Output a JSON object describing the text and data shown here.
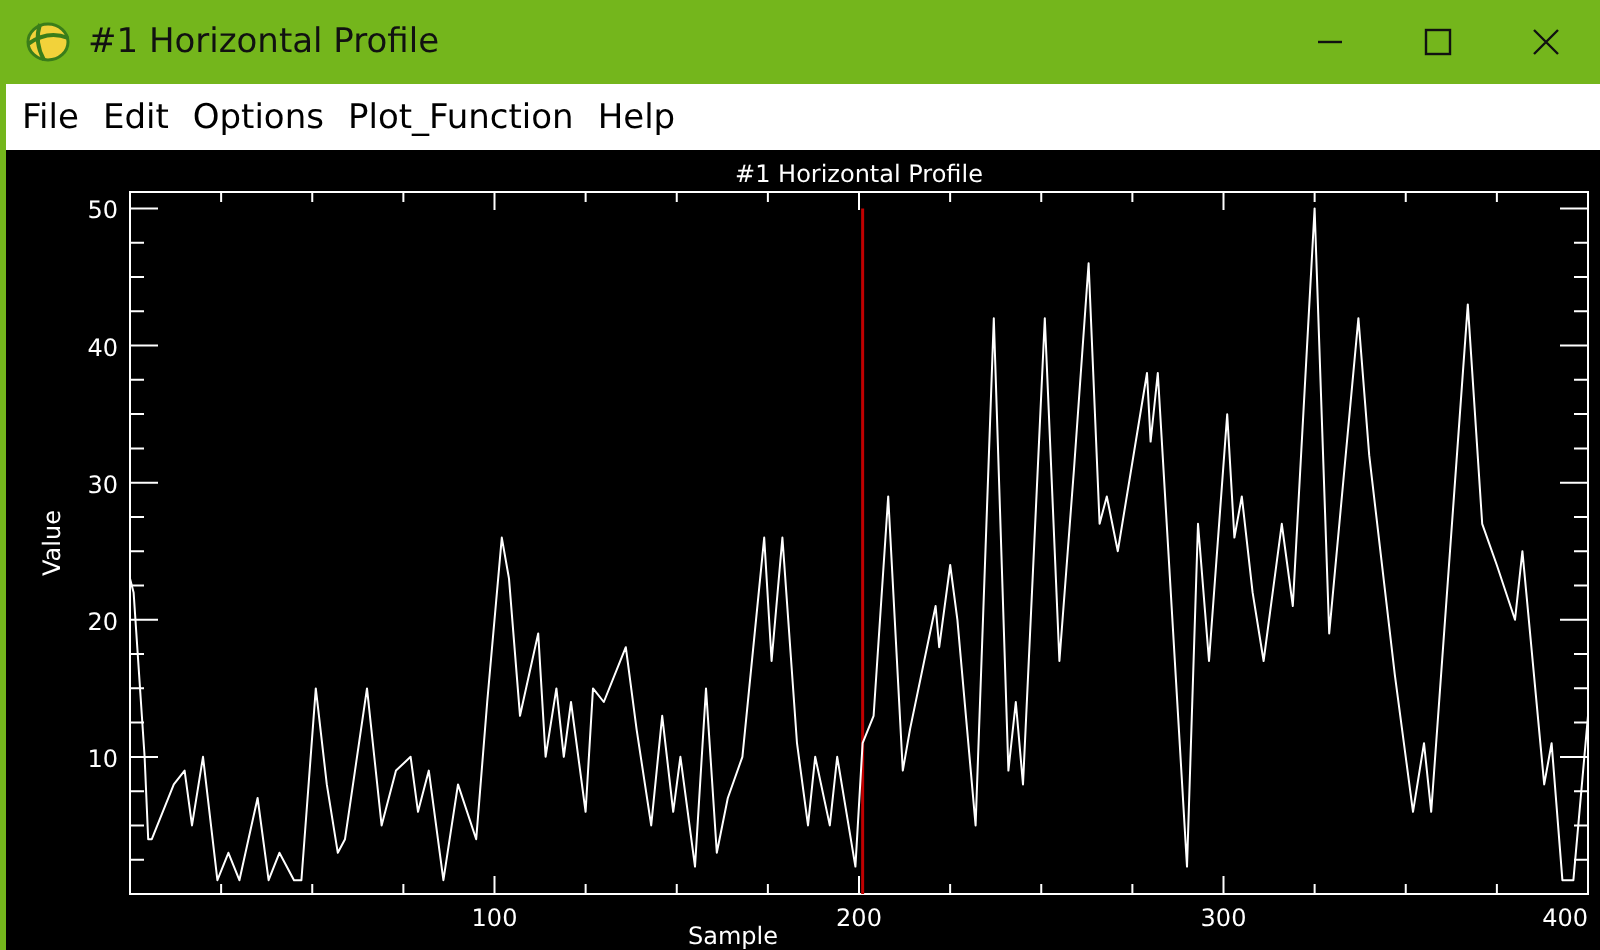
{
  "window": {
    "title": "#1 Horizontal Profile"
  },
  "menu": [
    "File",
    "Edit",
    "Options",
    "Plot_Function",
    "Help"
  ],
  "plot": {
    "chart_data": {
      "type": "line",
      "title": "#1 Horizontal Profile",
      "xlabel": "Sample",
      "ylabel": "Value",
      "xlim": [
        0,
        400
      ],
      "ylim": [
        0,
        51.2
      ],
      "xticks": [
        100,
        200,
        300,
        400
      ],
      "yticks": [
        10,
        20,
        30,
        40,
        50
      ],
      "x": [
        0,
        1,
        4,
        5,
        6,
        12,
        15,
        17,
        20,
        24,
        27,
        30,
        35,
        38,
        41,
        45,
        47,
        51,
        54,
        57,
        59,
        65,
        69,
        73,
        77,
        79,
        82,
        86,
        90,
        95,
        98,
        102,
        104,
        107,
        112,
        114,
        117,
        119,
        121,
        125,
        127,
        130,
        136,
        139,
        143,
        146,
        149,
        151,
        155,
        158,
        161,
        164,
        168,
        174,
        176,
        179,
        183,
        186,
        188,
        192,
        194,
        199,
        201,
        204,
        208,
        212,
        214,
        221,
        222,
        225,
        227,
        232,
        237,
        241,
        243,
        245,
        251,
        255,
        259,
        263,
        266,
        268,
        271,
        279,
        280,
        282,
        290,
        293,
        296,
        301,
        303,
        305,
        308,
        311,
        316,
        319,
        325,
        329,
        337,
        340,
        347,
        352,
        355,
        357,
        367,
        371,
        375,
        380,
        382,
        388,
        390,
        393,
        396,
        400
      ],
      "series": [
        {
          "color": "#ffffff",
          "values": [
            23,
            22,
            10,
            4,
            4,
            8,
            9,
            5,
            10,
            1,
            3,
            1,
            7,
            1,
            3,
            1,
            1,
            15,
            8,
            3,
            4,
            15,
            5,
            9,
            10,
            6,
            9,
            1,
            8,
            4,
            14,
            26,
            23,
            13,
            19,
            10,
            15,
            10,
            14,
            6,
            15,
            14,
            18,
            12,
            5,
            13,
            6,
            10,
            2,
            15,
            3,
            7,
            10,
            26,
            17,
            26,
            11,
            5,
            10,
            5,
            10,
            2,
            11,
            13,
            29,
            9,
            12,
            21,
            18,
            24,
            20,
            5,
            42,
            9,
            14,
            8,
            42,
            17,
            31,
            46,
            27,
            29,
            25,
            38,
            33,
            38,
            2,
            27,
            17,
            35,
            26,
            29,
            22,
            17,
            27,
            21,
            50,
            19,
            42,
            32,
            16,
            6,
            11,
            6,
            43,
            27,
            24,
            20,
            25,
            8,
            11,
            1,
            1,
            13
          ]
        }
      ],
      "ref_lines": [
        {
          "axis": "x",
          "value": 201,
          "color": "#c00000"
        }
      ]
    }
  }
}
